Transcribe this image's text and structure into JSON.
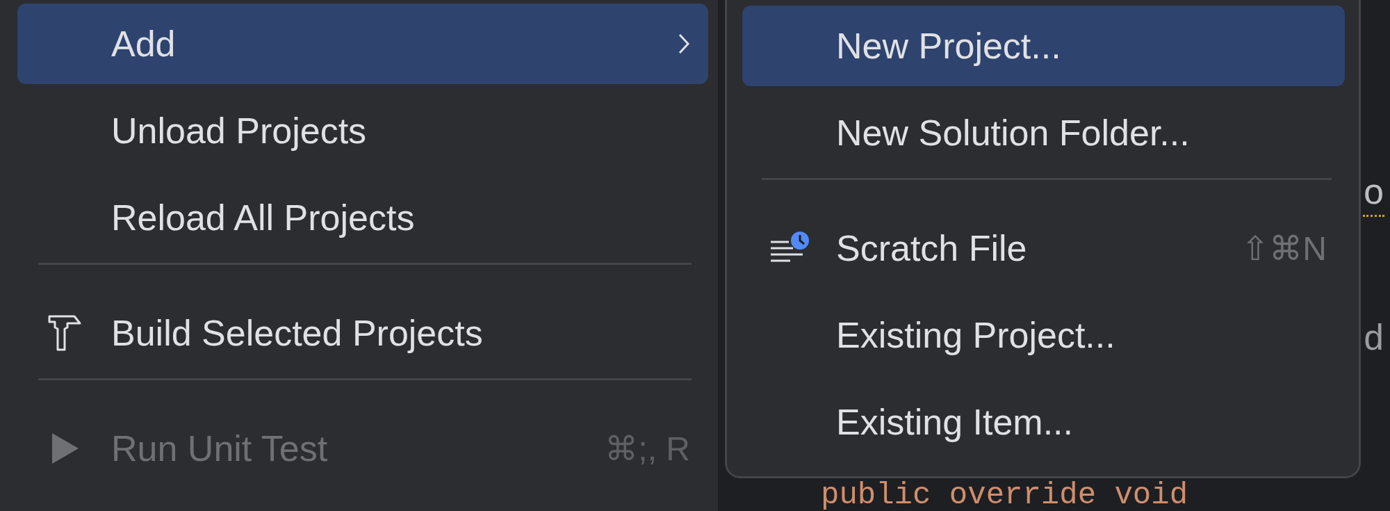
{
  "context_menu": {
    "items": [
      {
        "kind": "submenu",
        "label": "Add",
        "selected": true,
        "disabled": false
      },
      {
        "kind": "item",
        "label": "Unload Projects",
        "selected": false,
        "disabled": false
      },
      {
        "kind": "item",
        "label": "Reload All Projects",
        "selected": false,
        "disabled": false
      },
      {
        "kind": "separator"
      },
      {
        "kind": "build",
        "label": "Build Selected Projects",
        "selected": false,
        "disabled": false
      },
      {
        "kind": "separator"
      },
      {
        "kind": "run",
        "label": "Run Unit Test",
        "shortcut": "⌘;, R",
        "selected": false,
        "disabled": true
      }
    ]
  },
  "submenu": {
    "items": [
      {
        "kind": "item",
        "label": "New Project...",
        "selected": true
      },
      {
        "kind": "item",
        "label": "New Solution Folder...",
        "selected": false
      },
      {
        "kind": "separator"
      },
      {
        "kind": "scratch",
        "label": "Scratch File",
        "shortcut": "⇧⌘N",
        "selected": false
      },
      {
        "kind": "item",
        "label": "Existing Project...",
        "selected": false
      },
      {
        "kind": "item",
        "label": "Existing Item...",
        "selected": false
      }
    ]
  },
  "editor": {
    "code_lines": [
      "o",
      "d",
      "public override void"
    ]
  }
}
